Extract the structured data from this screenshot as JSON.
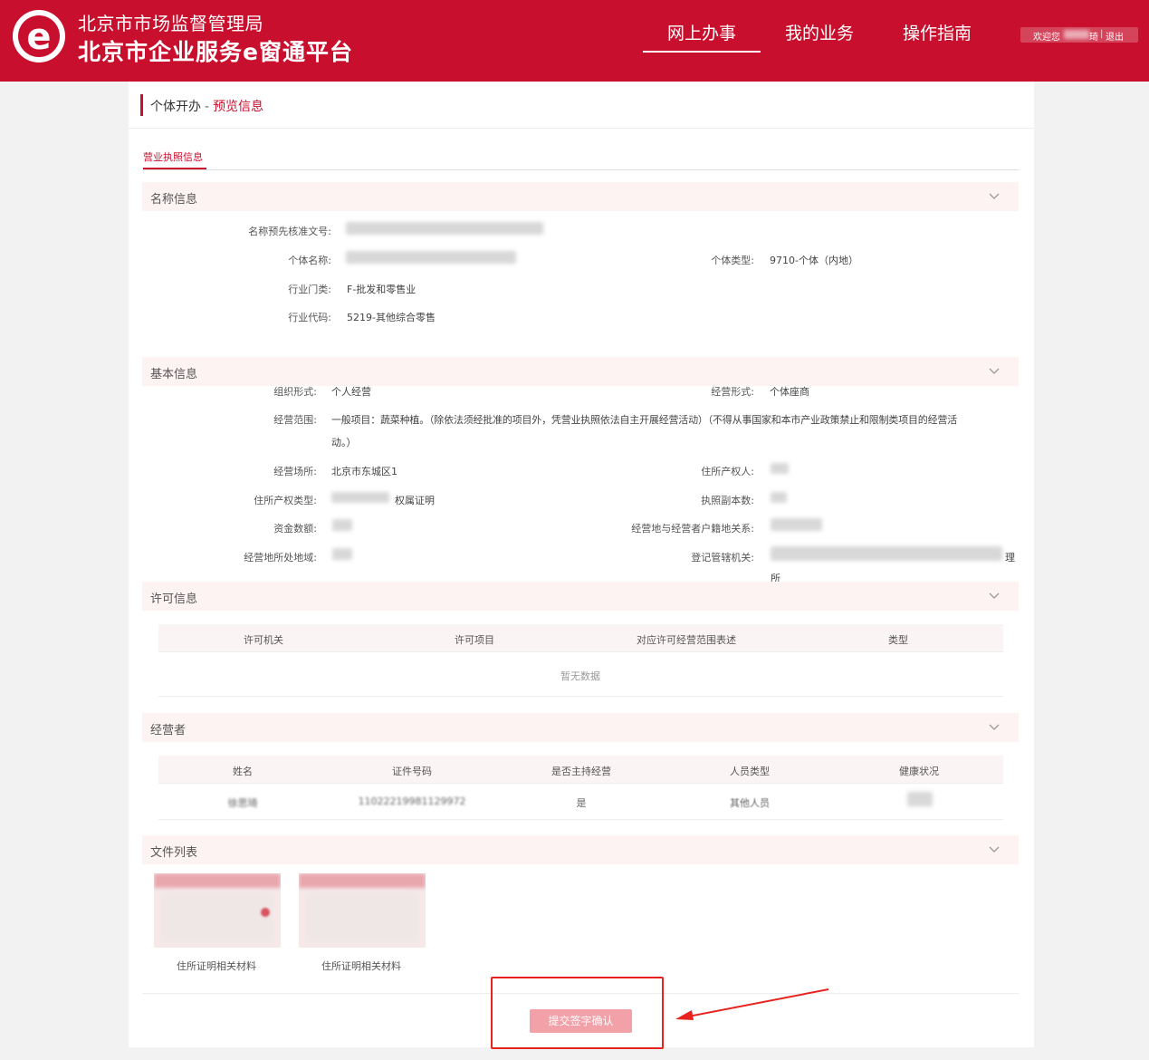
{
  "header": {
    "org_name": "北京市市场监督管理局",
    "platform_name": "北京市企业服务e窗通平台",
    "nav": [
      {
        "label": "网上办事",
        "active": true
      },
      {
        "label": "我的业务",
        "active": false
      },
      {
        "label": "操作指南",
        "active": false
      }
    ],
    "user_greeting": "欢迎您",
    "user_name_tail": "琦",
    "logout": "退出",
    "brand_color": "#c8102e"
  },
  "breadcrumb": {
    "root": "个体开办",
    "separator": "-",
    "current": "预览信息"
  },
  "tab": {
    "label": "营业执照信息"
  },
  "sections": {
    "name_info": {
      "title": "名称信息",
      "fields": {
        "approval_no_label": "名称预先核准文号:",
        "name_label": "个体名称:",
        "type_label": "个体类型:",
        "type_value": "9710-个体（内地）",
        "industry_cat_label": "行业门类:",
        "industry_cat_value": "F-批发和零售业",
        "industry_code_label": "行业代码:",
        "industry_code_value": "5219-其他综合零售"
      }
    },
    "basic_info": {
      "title": "基本信息",
      "fields": {
        "org_form_label": "组织形式:",
        "org_form_value": "个人经营",
        "biz_form_label": "经营形式:",
        "biz_form_value": "个体座商",
        "scope_label": "经营范围:",
        "scope_line1": "一般项目：蔬菜种植。（除依法须经批准的项目外，凭营业执照依法自主开展经营活动）（不得从事国家和本市产业政策禁止和限制类项目的经营活",
        "scope_line2": "动。）",
        "premises_label": "经营场所:",
        "premises_value": "北京市东城区1",
        "owner_label": "住所产权人:",
        "ptype_label": "住所产权类型:",
        "ptype_value": "权属证明",
        "copies_label": "执照副本数:",
        "capital_label": "资金数额:",
        "relation_label": "经营地与经营者户籍地关系:",
        "area_label": "经营地所处地域:",
        "authority_label": "登记管辖机关:",
        "authority_tail1": "理",
        "authority_tail2": "所"
      }
    },
    "license_info": {
      "title": "许可信息",
      "columns": [
        "许可机关",
        "许可项目",
        "对应许可经营范围表述",
        "类型"
      ],
      "empty_text": "暂无数据"
    },
    "operator": {
      "title": "经营者",
      "columns": [
        "姓名",
        "证件号码",
        "是否主持经营",
        "人员类型",
        "健康状况"
      ],
      "rows": [
        {
          "name": "徐思琦",
          "id_no": "11022219981129972",
          "is_host": "是",
          "person_type": "其他人员",
          "health": ""
        }
      ]
    },
    "files": {
      "title": "文件列表",
      "items": [
        {
          "caption": "住所证明相关材料"
        },
        {
          "caption": "住所证明相关材料"
        }
      ]
    }
  },
  "actions": {
    "submit_label": "提交签字确认"
  },
  "colors": {
    "accent": "#c8102e",
    "section_bg": "#fdf3f3",
    "submit_bg": "#f2a1a8",
    "annotation": "#e8231f"
  }
}
